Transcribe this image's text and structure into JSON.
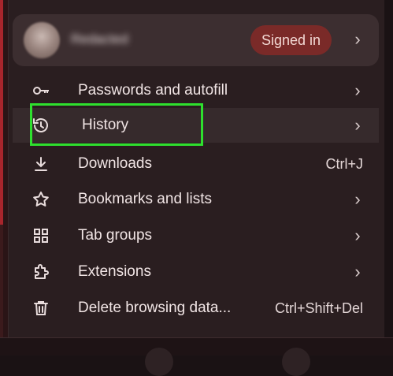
{
  "profile": {
    "name": "Redacted",
    "status_badge": "Signed in",
    "chevron": "›"
  },
  "menu": {
    "items": [
      {
        "label": "Passwords and autofill",
        "icon": "key-icon",
        "chevron": "›"
      },
      {
        "label": "History",
        "icon": "history-icon",
        "chevron": "›"
      },
      {
        "label": "Downloads",
        "icon": "download-icon",
        "shortcut": "Ctrl+J"
      },
      {
        "label": "Bookmarks and lists",
        "icon": "star-icon",
        "chevron": "›"
      },
      {
        "label": "Tab groups",
        "icon": "tab-groups-icon",
        "chevron": "›"
      },
      {
        "label": "Extensions",
        "icon": "extension-icon",
        "chevron": "›"
      },
      {
        "label": "Delete browsing data...",
        "icon": "trash-icon",
        "shortcut": "Ctrl+Shift+Del"
      }
    ]
  },
  "colors": {
    "menu_background": "#2a1e20",
    "highlight_row": "#362a2c",
    "signed_in_badge": "#7a2a28",
    "annotation_box": "#2ee02e"
  }
}
